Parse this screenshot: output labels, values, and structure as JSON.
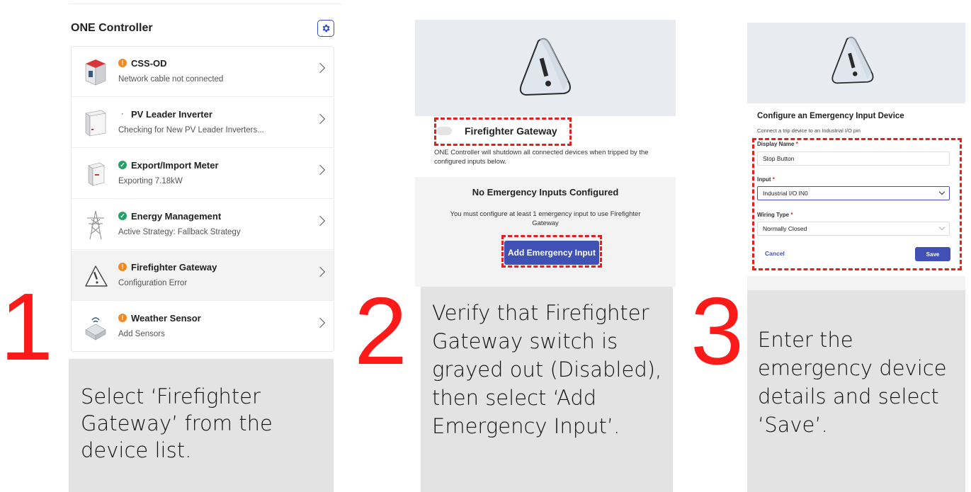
{
  "steps": {
    "one": {
      "number": "1",
      "caption": "Select ‘Firefighter Gateway’ from the device list."
    },
    "two": {
      "number": "2",
      "caption": "Verify that Firefighter Gateway switch is grayed out (Disabled), then select ‘Add Emergency Input’."
    },
    "three": {
      "number": "3",
      "caption": "Enter the emergency device details and select ‘Save’."
    }
  },
  "panel1": {
    "title": "ONE Controller",
    "devices": [
      {
        "name": "CSS-OD",
        "status": "warning",
        "sub": "Network cable not connected",
        "icon": "enclosure-icon"
      },
      {
        "name": "PV Leader Inverter",
        "status": "none",
        "sub": "Checking for New PV Leader Inverters...",
        "icon": "inverter-icon"
      },
      {
        "name": "Export/Import Meter",
        "status": "ok",
        "sub": "Exporting 7.18kW",
        "icon": "meter-icon"
      },
      {
        "name": "Energy Management",
        "status": "ok",
        "sub": "Active Strategy: Fallback Strategy",
        "icon": "pylon-icon"
      },
      {
        "name": "Firefighter Gateway",
        "status": "warning",
        "sub": "Configuration Error",
        "icon": "warning-triangle-icon",
        "selected": true
      },
      {
        "name": "Weather Sensor",
        "status": "warning",
        "sub": "Add Sensors",
        "icon": "weather-sensor-icon"
      }
    ]
  },
  "panel2": {
    "toggle_label": "Firefighter Gateway",
    "description": "ONE Controller will shutdown all connected devices when tripped by the configured inputs below.",
    "empty_title": "No Emergency Inputs Configured",
    "empty_body": "You must configure at least 1 emergency input to use Firefighter Gateway",
    "add_button": "Add Emergency Input"
  },
  "panel3": {
    "title": "Configure an Emergency Input Device",
    "subtitle": "Connect a trip device to an Industrial I/O pin",
    "display_name_label": "Display Name",
    "display_name_value": "Stop Button",
    "input_label": "Input",
    "input_value": "Industrial I/O IN0",
    "wiring_label": "Wiring Type",
    "wiring_value": "Normally Closed",
    "required_mark": "*",
    "cancel": "Cancel",
    "save": "Save"
  },
  "colors": {
    "accent": "#3f51b5",
    "warning": "#f08a24",
    "ok": "#25a06a",
    "highlight": "#e61e1e"
  }
}
